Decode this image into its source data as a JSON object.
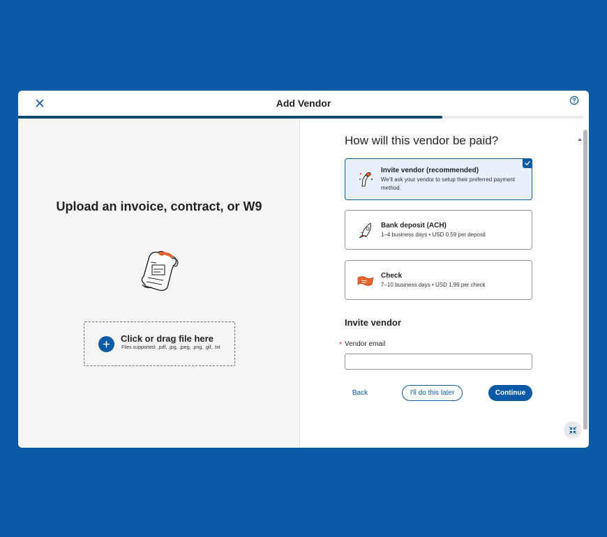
{
  "header": {
    "title": "Add Vendor",
    "close_icon": "close-icon",
    "help_icon": "help-circle-icon",
    "progress_fraction": 0.75
  },
  "upload": {
    "title": "Upload an invoice, contract, or W9",
    "dropzone_label": "Click or drag file here",
    "dropzone_sub": "Files supported: .pdf, .jpg, .jpeg, .png, .gif, .txt",
    "dropzone_icon": "plus-icon"
  },
  "payment": {
    "question": "How will this vendor be paid?",
    "options": [
      {
        "title": "Invite vendor (recommended)",
        "description": "We'll ask your vendor to setup their preferred payment method.",
        "icon": "invite-hand-icon",
        "selected": true
      },
      {
        "title": "Bank deposit (ACH)",
        "description": "1–4 business days • USD 0.59 per deposit",
        "icon": "rocket-icon",
        "selected": false
      },
      {
        "title": "Check",
        "description": "7–10 business days • USD 1.99 per check",
        "icon": "check-paper-icon",
        "selected": false
      }
    ]
  },
  "invite": {
    "section_title": "Invite vendor",
    "required_marker": "*",
    "email_label": "Vendor email",
    "email_value": "",
    "email_placeholder": ""
  },
  "actions": {
    "back": "Back",
    "later": "I'll do this later",
    "continue": "Continue"
  },
  "colors": {
    "background": "#0b5aa6",
    "accent": "#0b5aa6",
    "progress": "#0d4a6e",
    "selected_bg": "#e8f1fb"
  }
}
